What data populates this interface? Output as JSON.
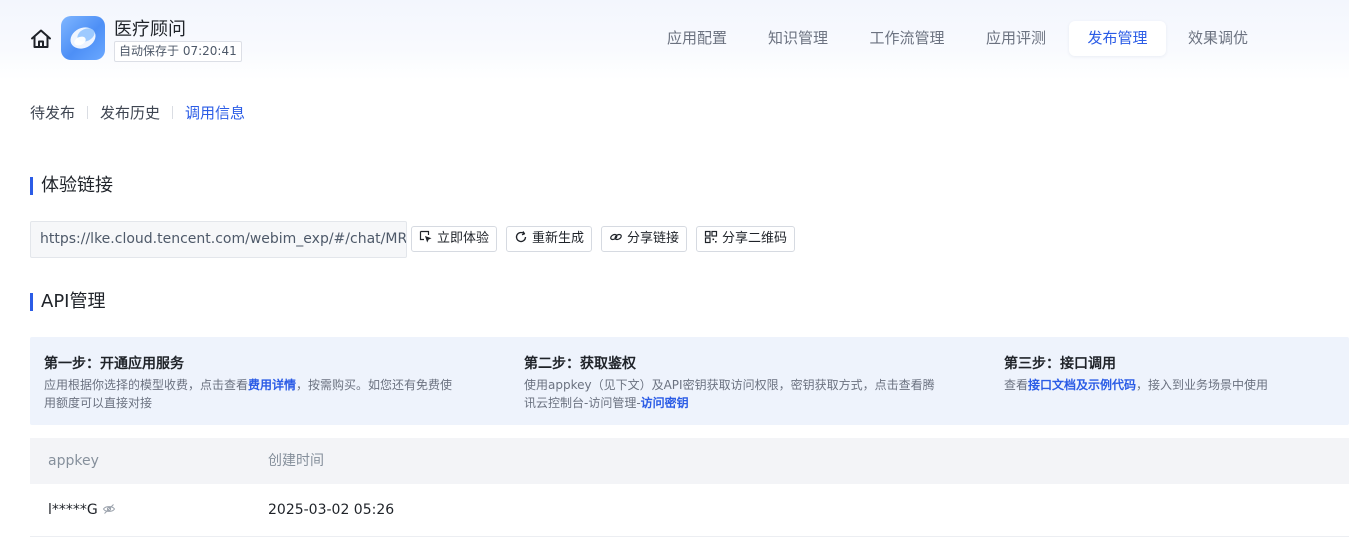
{
  "header": {
    "app_name": "医疗顾问",
    "autosave_label": "自动保存于",
    "autosave_time": "07:20:41",
    "icons": {
      "home": "home-icon",
      "logo": "app-logo"
    },
    "accent": "#2b5ce6"
  },
  "nav": {
    "tabs": [
      {
        "label": "应用配置"
      },
      {
        "label": "知识管理"
      },
      {
        "label": "工作流管理"
      },
      {
        "label": "应用评测"
      },
      {
        "label": "发布管理",
        "active": true
      },
      {
        "label": "效果调优"
      }
    ]
  },
  "subtabs": {
    "items": [
      {
        "label": "待发布"
      },
      {
        "label": "发布历史"
      },
      {
        "label": "调用信息",
        "active": true
      }
    ]
  },
  "experience": {
    "title": "体验链接",
    "url": "https://lke.cloud.tencent.com/webim_exp/#/chat/MRzYDb",
    "buttons": {
      "try": "立即体验",
      "regenerate": "重新生成",
      "share_link": "分享链接",
      "share_qr": "分享二维码"
    }
  },
  "api": {
    "title": "API管理",
    "steps": [
      {
        "title": "第一步：开通应用服务",
        "desc_line1_pre": "应用根据你选择的模型收费，点击查看",
        "link": "费用详情",
        "desc_line1_post": "，按需购买。如您还有免费使",
        "desc_line2": "用额度可以直接对接"
      },
      {
        "title": "第二步：获取鉴权",
        "desc_line1": "使用appkey（见下文）及API密钥获取访问权限，密钥获取方式，点击查看腾",
        "desc_line2_pre": "讯云控制台-访问管理-",
        "link": "访问密钥"
      },
      {
        "title": "第三步：接口调用",
        "desc_pre": "查看",
        "link": "接口文档及示例代码",
        "desc_post": "，接入到业务场景中使用"
      }
    ],
    "table": {
      "columns": [
        "appkey",
        "创建时间"
      ],
      "rows": [
        {
          "appkey": "l*****G",
          "created": "2025-03-02 05:26"
        }
      ]
    }
  }
}
